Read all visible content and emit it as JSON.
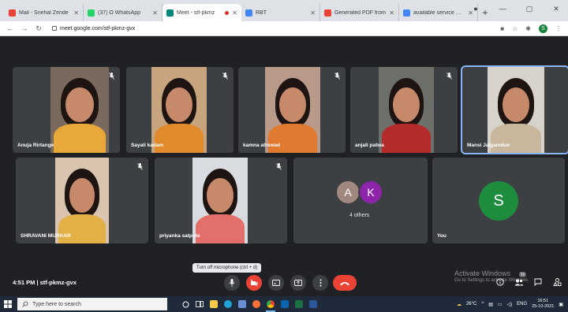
{
  "browser": {
    "tabs": [
      {
        "label": "Mail - Snehal Zende",
        "icon": "gmail-icon",
        "color": "#ea4335"
      },
      {
        "label": "(37) O WhatsApp",
        "icon": "whatsapp-icon",
        "color": "#25d366"
      },
      {
        "label": "Meet - stf-pkmz",
        "icon": "meet-icon",
        "color": "#00897b",
        "active": true
      },
      {
        "label": "RBT",
        "icon": "doc-icon",
        "color": "#4285f4"
      },
      {
        "label": "Generated PDF from",
        "icon": "gmail-icon",
        "color": "#ea4335"
      },
      {
        "label": "available service write",
        "icon": "google-icon",
        "color": "#4285f4"
      }
    ],
    "new_tab": "+",
    "url": "meet.google.com/stf-pkmz-gvx",
    "profile_initial": "S"
  },
  "meet": {
    "participants": [
      {
        "name": "Anuja Rirtange",
        "shirt": "#e8a93a",
        "bg": "#7a6a5e"
      },
      {
        "name": "Sayali kadam",
        "shirt": "#e08a2b",
        "bg": "#c8a47e"
      },
      {
        "name": "kamna atrewad",
        "shirt": "#e07a30",
        "bg": "#b99a8a"
      },
      {
        "name": "anjali patwa",
        "shirt": "#b32b2b",
        "bg": "#6d6f6a"
      },
      {
        "name": "Mansi Jaiganokar",
        "shirt": "#c9b79d",
        "bg": "#d7d2ca"
      },
      {
        "name": "SHRAVANI MURKAR",
        "shirt": "#e2b046",
        "bg": "#d9c4b0"
      },
      {
        "name": "priyanka satpute",
        "shirt": "#e26f6a",
        "bg": "#d8dce0"
      }
    ],
    "others": {
      "avatars": [
        {
          "letter": "A",
          "color": "#a1887f"
        },
        {
          "letter": "K",
          "color": "#8e24aa"
        }
      ],
      "label": "4 others"
    },
    "you": {
      "letter": "S",
      "color": "#1e8e3e",
      "label": "You"
    },
    "time": "4:51 PM",
    "meeting_code": "stf-pkmz-gvx",
    "tooltip": "Turn off microphone (ctrl + d)",
    "badge": "56"
  },
  "windows_notice": {
    "title": "Activate Windows",
    "subtitle": "Go to Settings to activate Windows."
  },
  "taskbar": {
    "search_placeholder": "Type here to search",
    "weather": "26°C",
    "lang": "ENG",
    "time": "16:51",
    "date": "25-10-2021"
  }
}
